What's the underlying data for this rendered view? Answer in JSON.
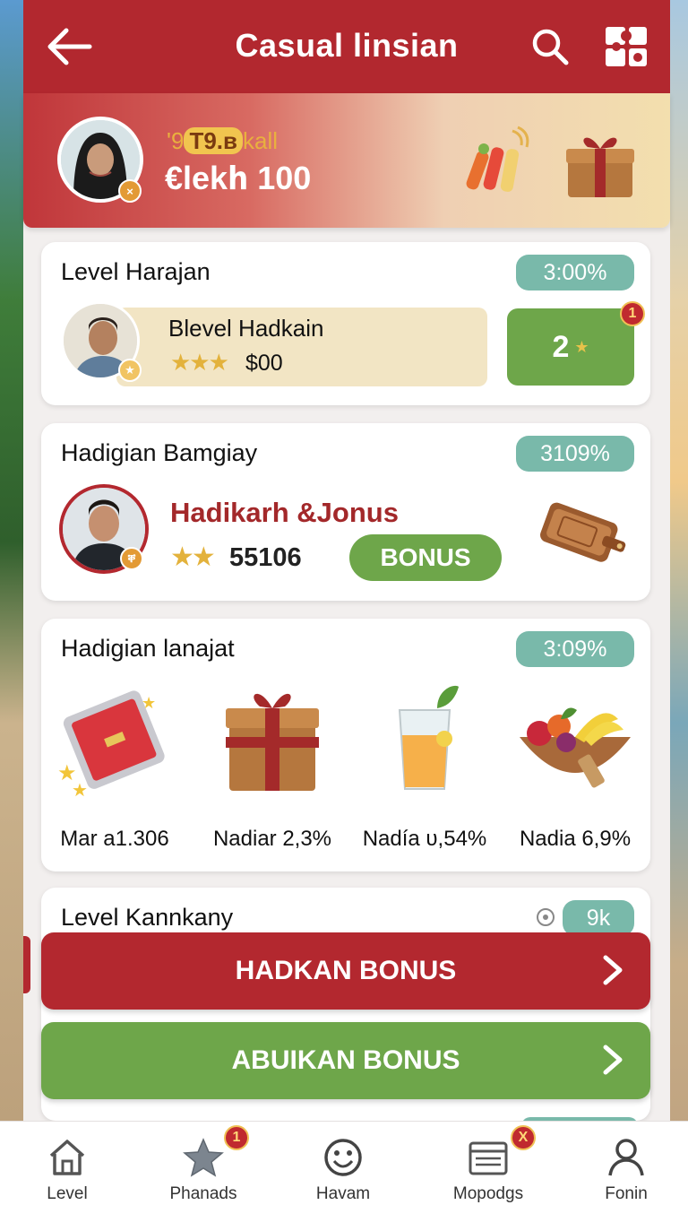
{
  "header": {
    "title": "Casual linsian",
    "icons": [
      "back-arrow-icon",
      "search-icon",
      "puzzle-icon"
    ]
  },
  "profile": {
    "sub_prefix": "'9",
    "sub_pill": "T9.в",
    "sub_suffix": "kall",
    "balance": "€lеkհ 100"
  },
  "card1": {
    "title": "Level Harajan",
    "percent": "3:00%",
    "name": "Blevel Hadkain",
    "stars": "★★★",
    "amount": "$00",
    "green_value": "2",
    "notif": "1"
  },
  "card2": {
    "title": "Hadigian Bamgiay",
    "percent": "3109%",
    "name": "Hadikarh &Jonus",
    "stars": "★★",
    "amount": "55106",
    "bonus_label": "BONUS"
  },
  "card3": {
    "title": "Hadigian lanajat",
    "percent": "3:09%",
    "items": [
      {
        "label": "Mar a1.306",
        "icon": "tablet-icon"
      },
      {
        "label": "Nadiar 2,3%",
        "icon": "gift-box-icon"
      },
      {
        "label": "Nadía υ,54%",
        "icon": "juice-glass-icon"
      },
      {
        "label": "Nadia 6,9%",
        "icon": "fruit-bowl-icon"
      }
    ]
  },
  "card4": {
    "title": "Level Kannkany",
    "percent": "9k"
  },
  "buttons": {
    "red": "HADKAN BONUS",
    "green": "ABUIKAN BONUS"
  },
  "nav": {
    "items": [
      {
        "label": "Level",
        "icon": "home-icon"
      },
      {
        "label": "Phanads",
        "icon": "star-icon",
        "badge": "1"
      },
      {
        "label": "Havam",
        "icon": "smiley-icon"
      },
      {
        "label": "Mopodgs",
        "icon": "calendar-icon",
        "badge": "X"
      },
      {
        "label": "Fonin",
        "icon": "user-icon"
      }
    ]
  },
  "colors": {
    "primary_red": "#b2282f",
    "accent_green": "#6ea64a",
    "teal_pill": "#79b9aa",
    "star_gold": "#e3b23c"
  }
}
